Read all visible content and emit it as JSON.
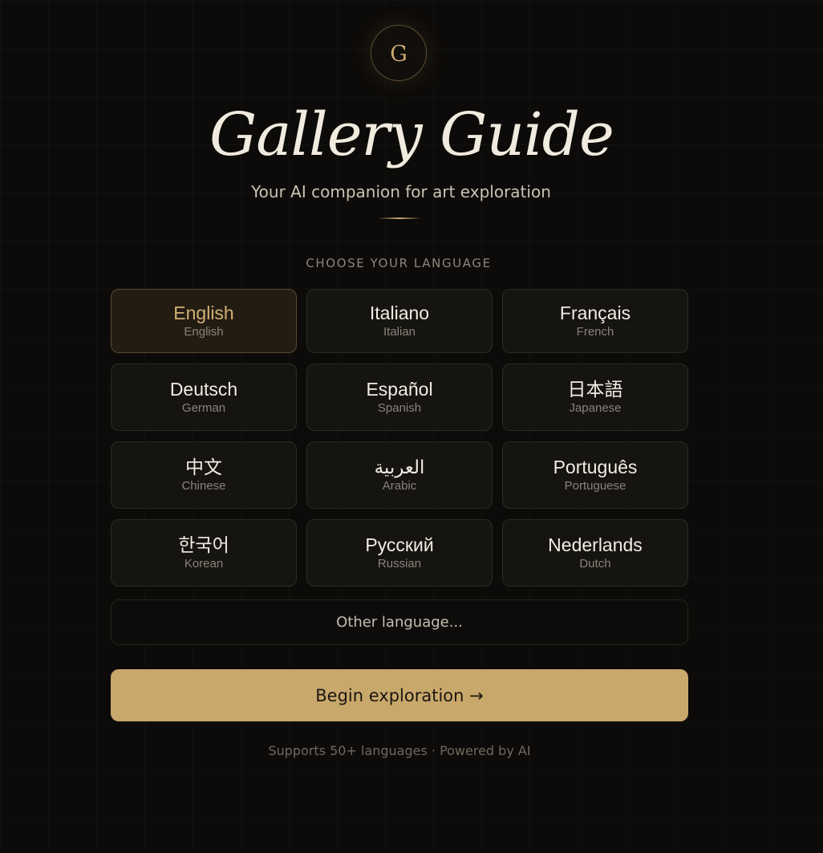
{
  "logo": {
    "letter": "G"
  },
  "header": {
    "title": "Gallery Guide",
    "subtitle": "Your AI companion for art exploration"
  },
  "language_section": {
    "label": "CHOOSE YOUR LANGUAGE",
    "selected": "English",
    "languages": [
      {
        "native": "English",
        "english": "English"
      },
      {
        "native": "Italiano",
        "english": "Italian"
      },
      {
        "native": "Français",
        "english": "French"
      },
      {
        "native": "Deutsch",
        "english": "German"
      },
      {
        "native": "Español",
        "english": "Spanish"
      },
      {
        "native": "日本語",
        "english": "Japanese"
      },
      {
        "native": "中文",
        "english": "Chinese"
      },
      {
        "native": "العربية",
        "english": "Arabic"
      },
      {
        "native": "Português",
        "english": "Portuguese"
      },
      {
        "native": "한국어",
        "english": "Korean"
      },
      {
        "native": "Русский",
        "english": "Russian"
      },
      {
        "native": "Nederlands",
        "english": "Dutch"
      }
    ],
    "other_label": "Other language..."
  },
  "actions": {
    "begin_label": "Begin exploration →"
  },
  "footer": {
    "text": "Supports 50+ languages · Powered by AI"
  },
  "colors": {
    "background": "#0d0b09",
    "accent": "#c9a86c",
    "card_background": "#151411",
    "selected_card_background": "#221c13"
  }
}
